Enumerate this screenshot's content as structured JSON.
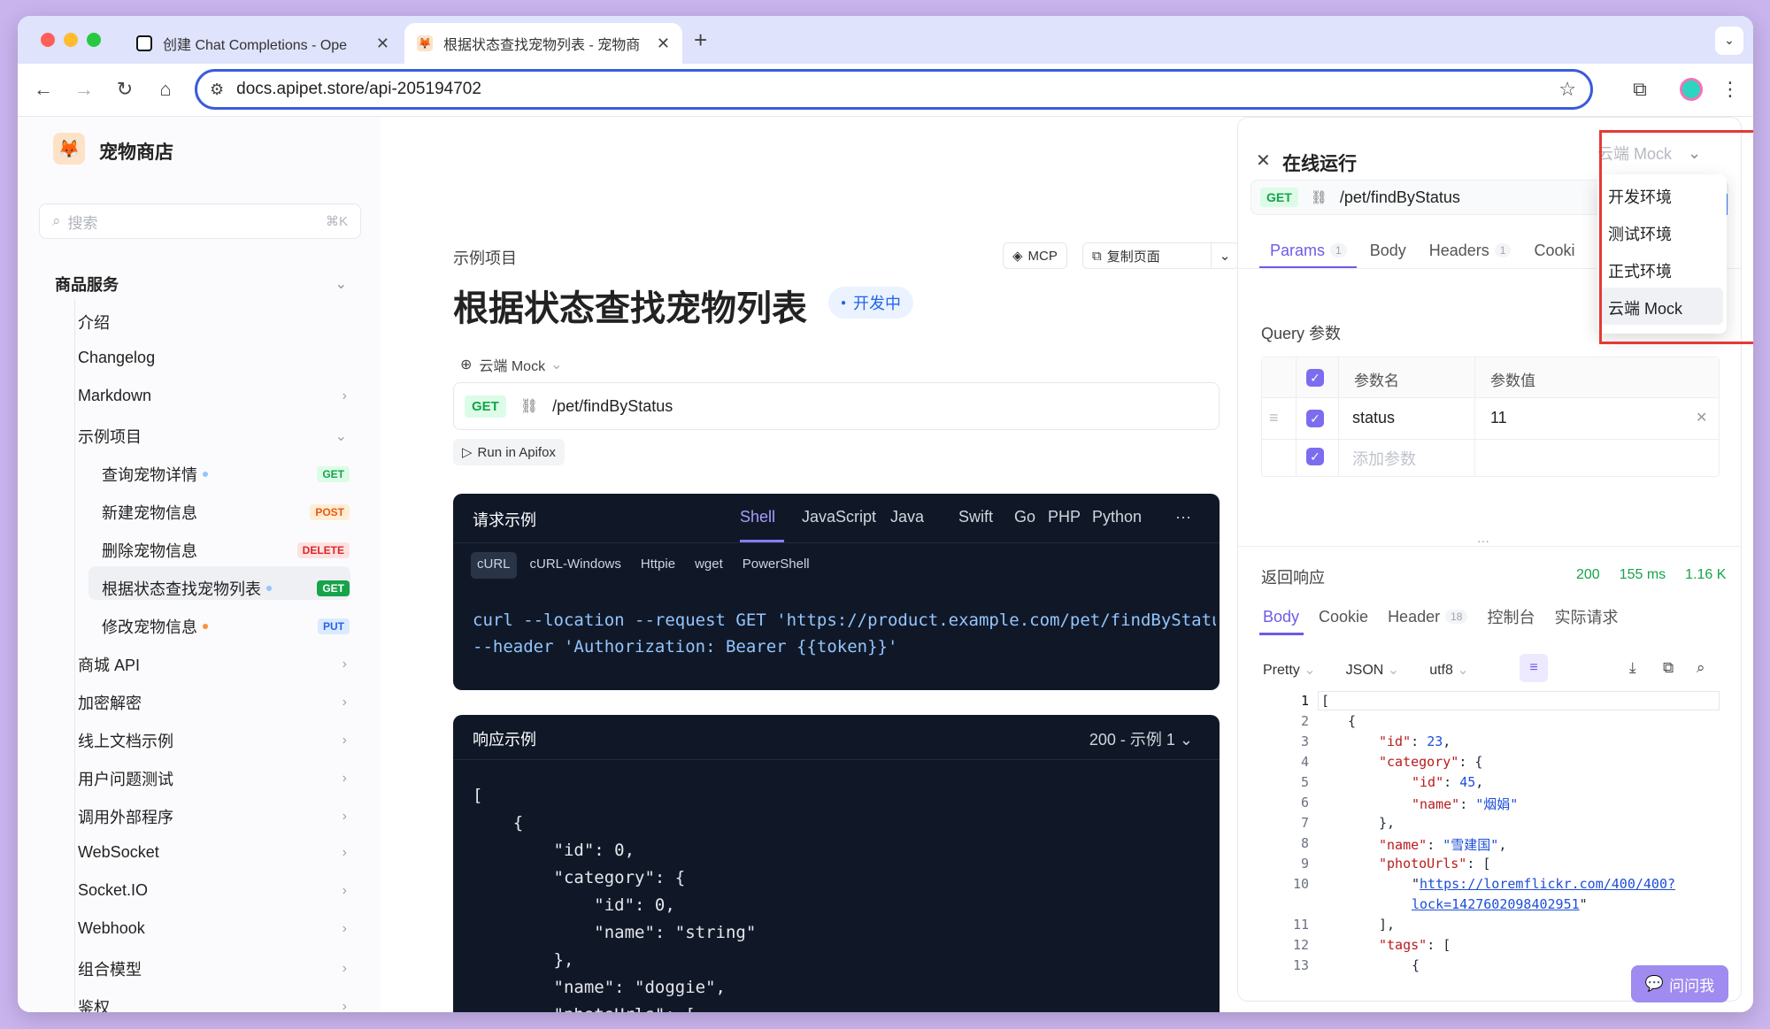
{
  "browser": {
    "tabs": [
      {
        "title": "创建 Chat Completions - Ope",
        "favicon_color": "#111111"
      },
      {
        "title": "根据状态查找宠物列表 - 宠物商",
        "favicon_color": "#f59e0b"
      }
    ],
    "new_tab": "+",
    "url": "docs.apipet.store/api-205194702"
  },
  "site": {
    "name": "宠物商店"
  },
  "sidebar": {
    "search_placeholder": "搜索",
    "search_shortcut": "⌘K",
    "group": "商品服务",
    "items": [
      "介绍",
      "Changelog",
      "Markdown",
      "示例项目"
    ],
    "sub_items": [
      {
        "label": "查询宠物详情",
        "method": "GET"
      },
      {
        "label": "新建宠物信息",
        "method": "POST"
      },
      {
        "label": "删除宠物信息",
        "method": "DELETE"
      },
      {
        "label": "根据状态查找宠物列表",
        "method": "GET"
      },
      {
        "label": "修改宠物信息",
        "method": "PUT"
      }
    ],
    "more_items": [
      "商城 API",
      "加密解密",
      "线上文档示例",
      "用户问题测试",
      "调用外部程序",
      "WebSocket",
      "Socket.IO",
      "Webhook",
      "组合模型",
      "鉴权"
    ]
  },
  "main": {
    "breadcrumb": "示例项目",
    "mcp_label": "MCP",
    "copy_label": "复制页面",
    "title": "根据状态查找宠物列表",
    "status": "开发中",
    "env": "云端 Mock",
    "method": "GET",
    "path": "/pet/findByStatus",
    "run_label": "Run in Apifox",
    "request": {
      "title": "请求示例",
      "langs": [
        "Shell",
        "JavaScript",
        "Java",
        "Swift",
        "Go",
        "PHP",
        "Python",
        "···"
      ],
      "variants": [
        "cURL",
        "cURL-Windows",
        "Httpie",
        "wget",
        "PowerShell"
      ],
      "code_line1": "curl --location --request GET 'https://product.example.com/pet/findByStatus?s",
      "code_line2": "--header 'Authorization: Bearer {{token}}'"
    },
    "response": {
      "title": "响应示例",
      "selector": "200 - 示例 1",
      "lines": [
        "[",
        "    {",
        "        \"id\": 0,",
        "        \"category\": {",
        "            \"id\": 0,",
        "            \"name\": \"string\"",
        "        },",
        "        \"name\": \"doggie\",",
        "        \"photoUrls\": ["
      ]
    }
  },
  "runner": {
    "title": "在线运行",
    "env_selected": "云端 Mock",
    "env_options": [
      "开发环境",
      "测试环境",
      "正式环境",
      "云端 Mock"
    ],
    "method": "GET",
    "path": "/pet/findByStatus",
    "tabs": [
      {
        "label": "Params",
        "count": "1"
      },
      {
        "label": "Body",
        "count": ""
      },
      {
        "label": "Headers",
        "count": "1"
      },
      {
        "label": "Cooki",
        "count": ""
      }
    ],
    "query_title": "Query 参数",
    "col_name": "参数名",
    "col_value": "参数值",
    "param_name": "status",
    "param_value": "11",
    "add_param": "添加参数",
    "resp_title": "返回响应",
    "resp_status": "200",
    "resp_time": "155 ms",
    "resp_size": "1.16 K",
    "resp_tabs": [
      {
        "label": "Body",
        "count": ""
      },
      {
        "label": "Cookie",
        "count": ""
      },
      {
        "label": "Header",
        "count": "18"
      },
      {
        "label": "控制台",
        "count": ""
      },
      {
        "label": "实际请求",
        "count": ""
      }
    ],
    "fmt": [
      "Pretty",
      "JSON",
      "utf8"
    ],
    "line_numbers": [
      "1",
      "2",
      "3",
      "4",
      "5",
      "6",
      "7",
      "8",
      "9",
      "10",
      "",
      "11",
      "12",
      "13"
    ],
    "ask_label": "问问我"
  },
  "colors": {
    "accent": "#6c5ce7",
    "highlight_border": "#e53935",
    "get_green": "#16a34a",
    "post_orange": "#ea580c",
    "delete_red": "#dc2626",
    "put_blue": "#2563eb"
  }
}
